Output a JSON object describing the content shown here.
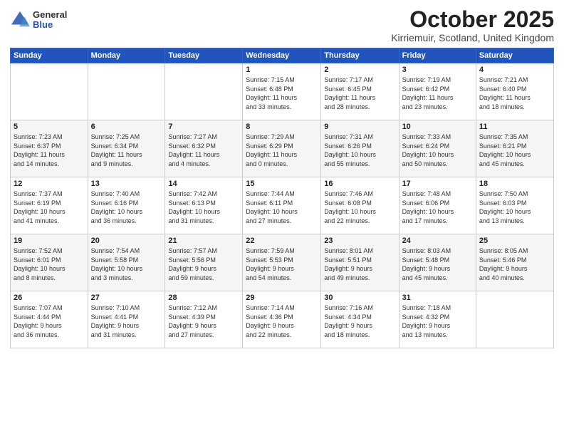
{
  "header": {
    "logo_general": "General",
    "logo_blue": "Blue",
    "month_title": "October 2025",
    "location": "Kirriemuir, Scotland, United Kingdom"
  },
  "days_of_week": [
    "Sunday",
    "Monday",
    "Tuesday",
    "Wednesday",
    "Thursday",
    "Friday",
    "Saturday"
  ],
  "weeks": [
    [
      {
        "day": "",
        "content": ""
      },
      {
        "day": "",
        "content": ""
      },
      {
        "day": "",
        "content": ""
      },
      {
        "day": "1",
        "content": "Sunrise: 7:15 AM\nSunset: 6:48 PM\nDaylight: 11 hours\nand 33 minutes."
      },
      {
        "day": "2",
        "content": "Sunrise: 7:17 AM\nSunset: 6:45 PM\nDaylight: 11 hours\nand 28 minutes."
      },
      {
        "day": "3",
        "content": "Sunrise: 7:19 AM\nSunset: 6:42 PM\nDaylight: 11 hours\nand 23 minutes."
      },
      {
        "day": "4",
        "content": "Sunrise: 7:21 AM\nSunset: 6:40 PM\nDaylight: 11 hours\nand 18 minutes."
      }
    ],
    [
      {
        "day": "5",
        "content": "Sunrise: 7:23 AM\nSunset: 6:37 PM\nDaylight: 11 hours\nand 14 minutes."
      },
      {
        "day": "6",
        "content": "Sunrise: 7:25 AM\nSunset: 6:34 PM\nDaylight: 11 hours\nand 9 minutes."
      },
      {
        "day": "7",
        "content": "Sunrise: 7:27 AM\nSunset: 6:32 PM\nDaylight: 11 hours\nand 4 minutes."
      },
      {
        "day": "8",
        "content": "Sunrise: 7:29 AM\nSunset: 6:29 PM\nDaylight: 11 hours\nand 0 minutes."
      },
      {
        "day": "9",
        "content": "Sunrise: 7:31 AM\nSunset: 6:26 PM\nDaylight: 10 hours\nand 55 minutes."
      },
      {
        "day": "10",
        "content": "Sunrise: 7:33 AM\nSunset: 6:24 PM\nDaylight: 10 hours\nand 50 minutes."
      },
      {
        "day": "11",
        "content": "Sunrise: 7:35 AM\nSunset: 6:21 PM\nDaylight: 10 hours\nand 45 minutes."
      }
    ],
    [
      {
        "day": "12",
        "content": "Sunrise: 7:37 AM\nSunset: 6:19 PM\nDaylight: 10 hours\nand 41 minutes."
      },
      {
        "day": "13",
        "content": "Sunrise: 7:40 AM\nSunset: 6:16 PM\nDaylight: 10 hours\nand 36 minutes."
      },
      {
        "day": "14",
        "content": "Sunrise: 7:42 AM\nSunset: 6:13 PM\nDaylight: 10 hours\nand 31 minutes."
      },
      {
        "day": "15",
        "content": "Sunrise: 7:44 AM\nSunset: 6:11 PM\nDaylight: 10 hours\nand 27 minutes."
      },
      {
        "day": "16",
        "content": "Sunrise: 7:46 AM\nSunset: 6:08 PM\nDaylight: 10 hours\nand 22 minutes."
      },
      {
        "day": "17",
        "content": "Sunrise: 7:48 AM\nSunset: 6:06 PM\nDaylight: 10 hours\nand 17 minutes."
      },
      {
        "day": "18",
        "content": "Sunrise: 7:50 AM\nSunset: 6:03 PM\nDaylight: 10 hours\nand 13 minutes."
      }
    ],
    [
      {
        "day": "19",
        "content": "Sunrise: 7:52 AM\nSunset: 6:01 PM\nDaylight: 10 hours\nand 8 minutes."
      },
      {
        "day": "20",
        "content": "Sunrise: 7:54 AM\nSunset: 5:58 PM\nDaylight: 10 hours\nand 3 minutes."
      },
      {
        "day": "21",
        "content": "Sunrise: 7:57 AM\nSunset: 5:56 PM\nDaylight: 9 hours\nand 59 minutes."
      },
      {
        "day": "22",
        "content": "Sunrise: 7:59 AM\nSunset: 5:53 PM\nDaylight: 9 hours\nand 54 minutes."
      },
      {
        "day": "23",
        "content": "Sunrise: 8:01 AM\nSunset: 5:51 PM\nDaylight: 9 hours\nand 49 minutes."
      },
      {
        "day": "24",
        "content": "Sunrise: 8:03 AM\nSunset: 5:48 PM\nDaylight: 9 hours\nand 45 minutes."
      },
      {
        "day": "25",
        "content": "Sunrise: 8:05 AM\nSunset: 5:46 PM\nDaylight: 9 hours\nand 40 minutes."
      }
    ],
    [
      {
        "day": "26",
        "content": "Sunrise: 7:07 AM\nSunset: 4:44 PM\nDaylight: 9 hours\nand 36 minutes."
      },
      {
        "day": "27",
        "content": "Sunrise: 7:10 AM\nSunset: 4:41 PM\nDaylight: 9 hours\nand 31 minutes."
      },
      {
        "day": "28",
        "content": "Sunrise: 7:12 AM\nSunset: 4:39 PM\nDaylight: 9 hours\nand 27 minutes."
      },
      {
        "day": "29",
        "content": "Sunrise: 7:14 AM\nSunset: 4:36 PM\nDaylight: 9 hours\nand 22 minutes."
      },
      {
        "day": "30",
        "content": "Sunrise: 7:16 AM\nSunset: 4:34 PM\nDaylight: 9 hours\nand 18 minutes."
      },
      {
        "day": "31",
        "content": "Sunrise: 7:18 AM\nSunset: 4:32 PM\nDaylight: 9 hours\nand 13 minutes."
      },
      {
        "day": "",
        "content": ""
      }
    ]
  ]
}
